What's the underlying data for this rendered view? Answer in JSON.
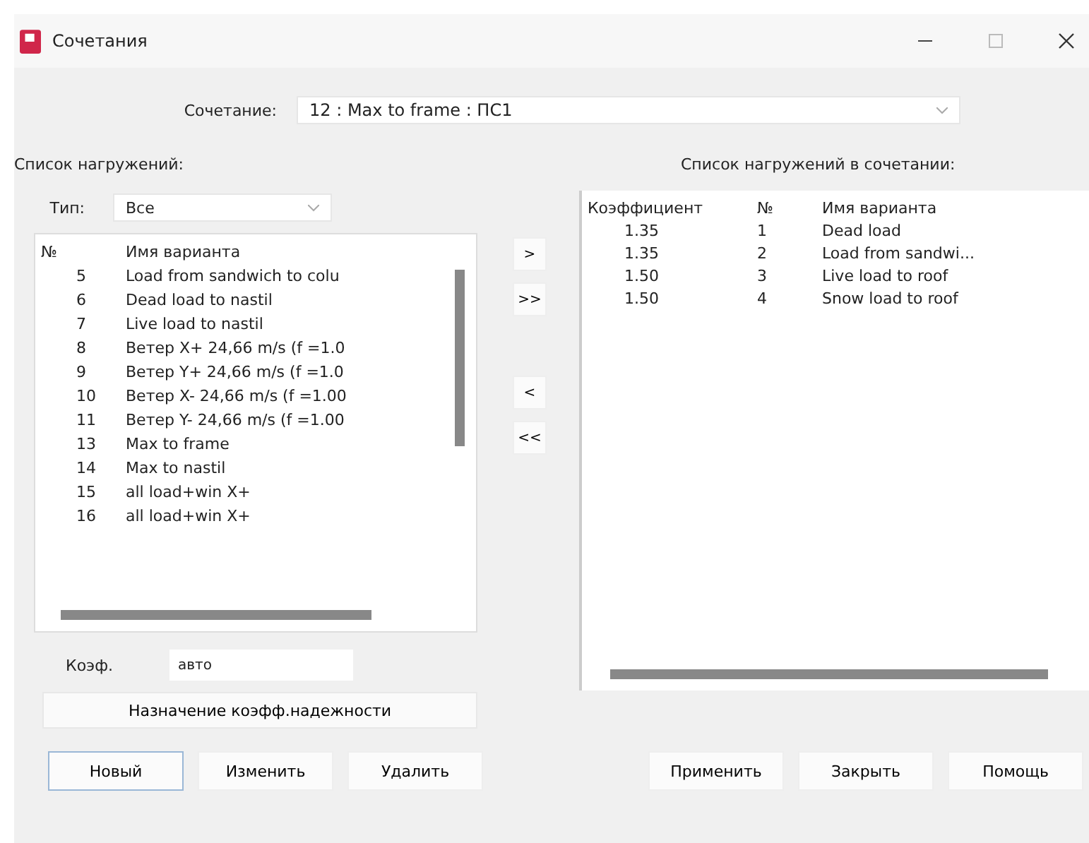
{
  "window": {
    "title": "Сочетания"
  },
  "combination": {
    "label": "Сочетание:",
    "value": "12 : Max to frame : ПС1"
  },
  "left": {
    "title": "Список нагружений:",
    "type_label": "Тип:",
    "type_value": "Все",
    "columns": [
      "№",
      "Имя варианта"
    ],
    "rows": [
      {
        "no": "5",
        "name": "Load from sandwich to colu"
      },
      {
        "no": "6",
        "name": "Dead load to nastil"
      },
      {
        "no": "7",
        "name": "Live load to nastil"
      },
      {
        "no": "8",
        "name": "Ветер X+ 24,66 m/s (f =1.0"
      },
      {
        "no": "9",
        "name": "Ветер Y+ 24,66 m/s (f =1.0"
      },
      {
        "no": "10",
        "name": "Ветер X- 24,66 m/s (f =1.00"
      },
      {
        "no": "11",
        "name": "Ветер Y- 24,66 m/s (f =1.00"
      },
      {
        "no": "13",
        "name": "Max to frame"
      },
      {
        "no": "14",
        "name": "Max to nastil"
      },
      {
        "no": "15",
        "name": "all load+win X+"
      },
      {
        "no": "16",
        "name": "all load+win X+"
      }
    ],
    "coef_label": "Коэф.",
    "coef_value": "авто",
    "reliability_button": "Назначение коэфф.надежности"
  },
  "transfer_buttons": [
    ">",
    ">>",
    "<",
    "<<"
  ],
  "right": {
    "title": "Список нагружений в сочетании:",
    "columns": [
      "Коэффициент",
      "№",
      "Имя варианта"
    ],
    "rows": [
      {
        "coef": "1.35",
        "no": "1",
        "name": "Dead load"
      },
      {
        "coef": "1.35",
        "no": "2",
        "name": "Load from sandwi..."
      },
      {
        "coef": "1.50",
        "no": "3",
        "name": "Live load to roof"
      },
      {
        "coef": "1.50",
        "no": "4",
        "name": "Snow load to roof"
      }
    ]
  },
  "left_buttons": [
    {
      "label": "Новый",
      "selected": true
    },
    {
      "label": "Изменить",
      "selected": false
    },
    {
      "label": "Удалить",
      "selected": false
    }
  ],
  "right_buttons": [
    "Применить",
    "Закрыть",
    "Помощь"
  ]
}
